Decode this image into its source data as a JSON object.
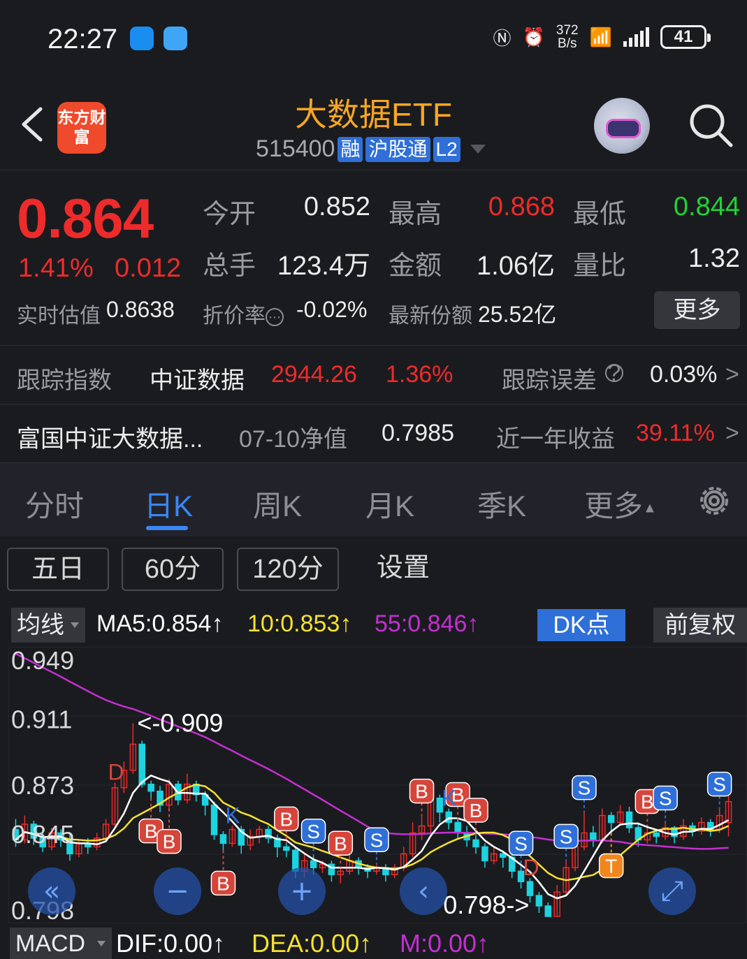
{
  "status_bar": {
    "time": "22:27",
    "net_speed_value": "372",
    "net_speed_unit": "B/s",
    "battery": "41"
  },
  "header": {
    "logo_text": "东方财富",
    "title": "大数据ETF",
    "code": "515400",
    "tags": [
      "融",
      "沪股通",
      "L2"
    ]
  },
  "quote": {
    "price": "0.864",
    "change_pct": "1.41%",
    "change": "0.012",
    "open_label": "今开",
    "open": "0.852",
    "high_label": "最高",
    "high": "0.868",
    "low_label": "最低",
    "low": "0.844",
    "volume_label": "总手",
    "volume": "123.4万",
    "amount_label": "金额",
    "amount": "1.06亿",
    "vol_ratio_label": "量比",
    "vol_ratio": "1.32",
    "iopv_label": "实时估值",
    "iopv": "0.8638",
    "discount_label": "折价率",
    "discount": "-0.02%",
    "shares_label": "最新份额",
    "shares": "25.52亿",
    "more_label": "更多"
  },
  "tracking": {
    "label": "跟踪指数",
    "index_name": "中证数据",
    "index_value": "2944.26",
    "index_pct": "1.36%",
    "error_label": "跟踪误差",
    "error_value": "0.03%",
    "fund_name": "富国中证大数据...",
    "nav_label": "07-10净值",
    "nav_value": "0.7985",
    "yield_label": "近一年收益",
    "yield_value": "39.11%",
    "chevron": ">"
  },
  "tabs": [
    "分时",
    "日K",
    "周K",
    "月K",
    "季K",
    "更多"
  ],
  "active_tab": "日K",
  "sub_tabs": [
    "五日",
    "60分",
    "120分",
    "设置"
  ],
  "ma_bar": {
    "selector": "均线",
    "ma5": "MA5:0.854",
    "ma10": "10:0.853",
    "ma55": "55:0.846",
    "arrow": "↑",
    "dk_label": "DK点",
    "adjust_label": "前复权"
  },
  "colors": {
    "up": "#ee2b2b",
    "down": "#1dd3e0",
    "ma5": "#ffffff",
    "ma10": "#f5e12e",
    "ma55": "#c42fd1",
    "accent": "#2f6fd8",
    "active_tab": "#3b86f5"
  },
  "chart_data": {
    "type": "candlestick",
    "y_tick_labels": [
      "0.949",
      "0.911",
      "0.873",
      "0.845",
      "0.798"
    ],
    "max_annotation": "<-0.909",
    "min_annotation": "0.798->",
    "markers": [
      "B",
      "S",
      "D",
      "K",
      "T"
    ],
    "ylim": [
      0.798,
      0.949
    ],
    "candles": [
      [
        0.848,
        0.842,
        0.854,
        0.838
      ],
      [
        0.842,
        0.851,
        0.856,
        0.84
      ],
      [
        0.851,
        0.843,
        0.853,
        0.839
      ],
      [
        0.843,
        0.838,
        0.846,
        0.835
      ],
      [
        0.838,
        0.846,
        0.849,
        0.836
      ],
      [
        0.846,
        0.842,
        0.848,
        0.838
      ],
      [
        0.842,
        0.834,
        0.845,
        0.83
      ],
      [
        0.834,
        0.84,
        0.842,
        0.832
      ],
      [
        0.84,
        0.838,
        0.843,
        0.834
      ],
      [
        0.838,
        0.843,
        0.846,
        0.836
      ],
      [
        0.843,
        0.851,
        0.854,
        0.841
      ],
      [
        0.851,
        0.872,
        0.875,
        0.849
      ],
      [
        0.872,
        0.882,
        0.887,
        0.869
      ],
      [
        0.882,
        0.897,
        0.909,
        0.88
      ],
      [
        0.897,
        0.874,
        0.899,
        0.872
      ],
      [
        0.874,
        0.87,
        0.876,
        0.866
      ],
      [
        0.87,
        0.862,
        0.873,
        0.858
      ],
      [
        0.862,
        0.874,
        0.877,
        0.86
      ],
      [
        0.874,
        0.865,
        0.876,
        0.862
      ],
      [
        0.865,
        0.874,
        0.88,
        0.863
      ],
      [
        0.874,
        0.868,
        0.876,
        0.864
      ],
      [
        0.868,
        0.862,
        0.87,
        0.856
      ],
      [
        0.862,
        0.845,
        0.864,
        0.842
      ],
      [
        0.845,
        0.84,
        0.847,
        0.836
      ],
      [
        0.84,
        0.848,
        0.85,
        0.838
      ],
      [
        0.848,
        0.839,
        0.85,
        0.834
      ],
      [
        0.839,
        0.844,
        0.848,
        0.836
      ],
      [
        0.844,
        0.848,
        0.85,
        0.84
      ],
      [
        0.848,
        0.843,
        0.85,
        0.84
      ],
      [
        0.843,
        0.838,
        0.845,
        0.832
      ],
      [
        0.838,
        0.836,
        0.84,
        0.832
      ],
      [
        0.836,
        0.824,
        0.838,
        0.82
      ],
      [
        0.824,
        0.83,
        0.834,
        0.82
      ],
      [
        0.83,
        0.826,
        0.833,
        0.822
      ],
      [
        0.826,
        0.828,
        0.83,
        0.823
      ],
      [
        0.828,
        0.822,
        0.83,
        0.818
      ],
      [
        0.822,
        0.824,
        0.826,
        0.817
      ],
      [
        0.824,
        0.83,
        0.836,
        0.822
      ],
      [
        0.83,
        0.826,
        0.832,
        0.822
      ],
      [
        0.826,
        0.824,
        0.828,
        0.82
      ],
      [
        0.824,
        0.826,
        0.828,
        0.822
      ],
      [
        0.826,
        0.822,
        0.828,
        0.818
      ],
      [
        0.822,
        0.826,
        0.828,
        0.82
      ],
      [
        0.826,
        0.834,
        0.838,
        0.824
      ],
      [
        0.834,
        0.846,
        0.852,
        0.832
      ],
      [
        0.846,
        0.85,
        0.856,
        0.842
      ],
      [
        0.85,
        0.866,
        0.869,
        0.846
      ],
      [
        0.866,
        0.858,
        0.868,
        0.852
      ],
      [
        0.858,
        0.852,
        0.86,
        0.848
      ],
      [
        0.852,
        0.846,
        0.854,
        0.842
      ],
      [
        0.846,
        0.842,
        0.85,
        0.838
      ],
      [
        0.842,
        0.838,
        0.845,
        0.834
      ],
      [
        0.838,
        0.83,
        0.84,
        0.826
      ],
      [
        0.83,
        0.834,
        0.838,
        0.828
      ],
      [
        0.834,
        0.832,
        0.836,
        0.826
      ],
      [
        0.832,
        0.824,
        0.834,
        0.82
      ],
      [
        0.824,
        0.818,
        0.826,
        0.814
      ],
      [
        0.818,
        0.81,
        0.82,
        0.806
      ],
      [
        0.81,
        0.804,
        0.812,
        0.8
      ],
      [
        0.804,
        0.798,
        0.806,
        0.798
      ],
      [
        0.798,
        0.812,
        0.816,
        0.798
      ],
      [
        0.812,
        0.826,
        0.83,
        0.81
      ],
      [
        0.826,
        0.838,
        0.842,
        0.824
      ],
      [
        0.838,
        0.846,
        0.858,
        0.836
      ],
      [
        0.846,
        0.842,
        0.85,
        0.838
      ],
      [
        0.842,
        0.856,
        0.86,
        0.84
      ],
      [
        0.856,
        0.852,
        0.858,
        0.846
      ],
      [
        0.852,
        0.858,
        0.862,
        0.85
      ],
      [
        0.858,
        0.849,
        0.861,
        0.846
      ],
      [
        0.849,
        0.842,
        0.852,
        0.838
      ],
      [
        0.842,
        0.846,
        0.85,
        0.84
      ],
      [
        0.846,
        0.844,
        0.848,
        0.84
      ],
      [
        0.844,
        0.849,
        0.852,
        0.842
      ],
      [
        0.849,
        0.844,
        0.85,
        0.84
      ],
      [
        0.844,
        0.85,
        0.854,
        0.842
      ],
      [
        0.85,
        0.847,
        0.852,
        0.844
      ],
      [
        0.847,
        0.852,
        0.855,
        0.845
      ],
      [
        0.852,
        0.848,
        0.854,
        0.844
      ],
      [
        0.848,
        0.856,
        0.86,
        0.846
      ],
      [
        0.852,
        0.864,
        0.868,
        0.844
      ]
    ]
  },
  "macd_bar": {
    "selector": "MACD",
    "dif": "DIF:0.00",
    "dea": "DEA:0.00",
    "m": "M:0.00",
    "arrow": "↑"
  }
}
